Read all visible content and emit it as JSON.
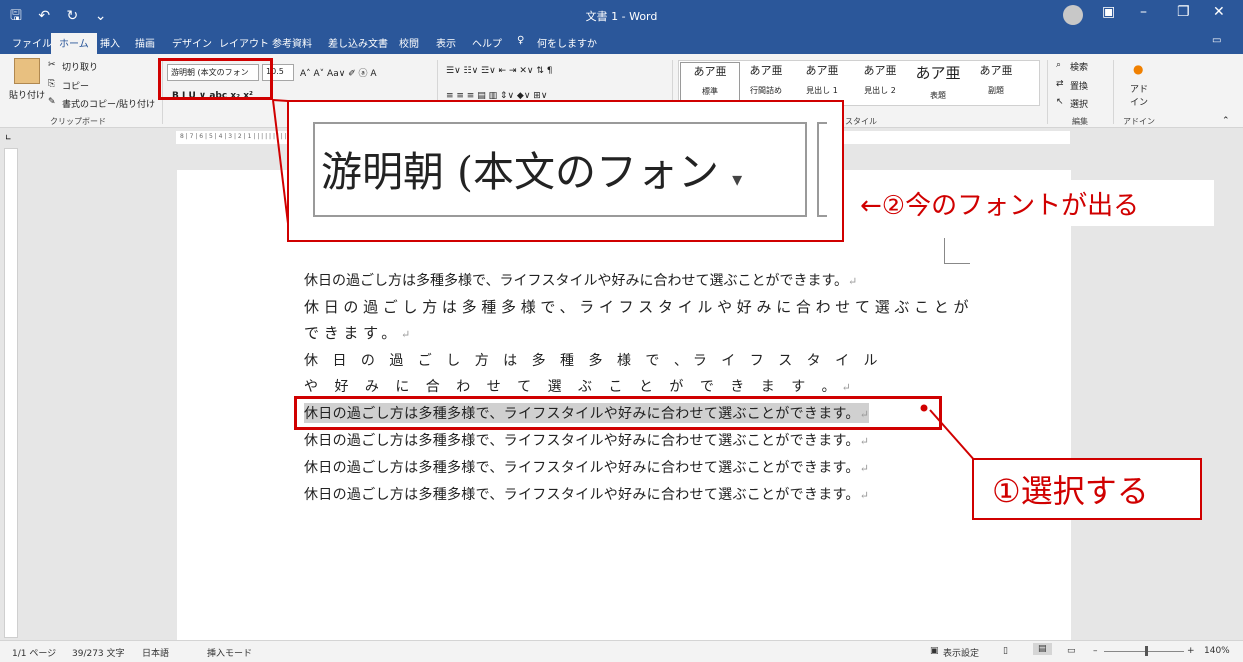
{
  "window": {
    "title": "文書 1  -  Word"
  },
  "tabs": [
    {
      "label": "ファイル",
      "active": false
    },
    {
      "label": "ホーム",
      "active": true
    },
    {
      "label": "挿入",
      "active": false
    },
    {
      "label": "描画",
      "active": false
    },
    {
      "label": "デザイン",
      "active": false
    },
    {
      "label": "レイアウト",
      "active": false
    },
    {
      "label": "参考資料",
      "active": false
    },
    {
      "label": "差し込み文書",
      "active": false
    },
    {
      "label": "校閲",
      "active": false
    },
    {
      "label": "表示",
      "active": false
    },
    {
      "label": "ヘルプ",
      "active": false
    }
  ],
  "tellme": "何をしますか",
  "clipboard": {
    "paste": "貼り付け",
    "cut": "切り取り",
    "copy": "コピー",
    "format_painter": "書式のコピー/貼り付け",
    "group": "クリップボード"
  },
  "font": {
    "name": "游明朝 (本文のフォン",
    "size": "10.5",
    "format_buttons": "B  I  U ∨  abc  x₂  x²"
  },
  "styles": {
    "items": [
      {
        "sample": "あア亜",
        "label": "標準"
      },
      {
        "sample": "あア亜",
        "label": "行間詰め"
      },
      {
        "sample": "あア亜",
        "label": "見出し 1"
      },
      {
        "sample": "あア亜",
        "label": "見出し 2"
      },
      {
        "sample": "あア亜",
        "label": "表題"
      },
      {
        "sample": "あア亜",
        "label": "副題"
      }
    ],
    "group": "スタイル"
  },
  "editing": {
    "find": "検索",
    "replace": "置換",
    "select": "選択",
    "group": "編集"
  },
  "addins": {
    "label": "アド\nイン",
    "group": "アドイン"
  },
  "ruler_text": "8 | 7 | 6 | 5 | 4 | 3 | 2 | 1 |      |      |      |      |      |      |      |      |      |      |      |      |      |      |      |      |      |      |      |      |      |      |      |      |      |      |      |      |      |      |      |      |      |      |      |      |      |      |      |      |      |      |      |      |      |      |      |      |      |      |      | 35 | 36 | 37 | 38 | 39 | 40 | 41 | 42 | 43 | 44 | 45 | 46 | 47 | 48 |",
  "document": {
    "lines": [
      "休日の過ごし方は多種多様で、ライフスタイルや好みに合わせて選ぶことができます。",
      "休日の過ごし方は多種多様で、ライフスタイルや好みに合わせて選ぶことが",
      "できます。",
      "休 日 の 過 ご し 方 は 多 種 多 様 で 、ラ イ フ ス タ イ ル",
      "や 好 み に 合 わ せ て 選 ぶ こ と が で き ま す 。",
      "休日の過ごし方は多種多様で、ライフスタイルや好みに合わせて選ぶことができます。",
      "休日の過ごし方は多種多様で、ライフスタイルや好みに合わせて選ぶことができます。",
      "休日の過ごし方は多種多様で、ライフスタイルや好みに合わせて選ぶことができます。",
      "休日の過ごし方は多種多様で、ライフスタイルや好みに合わせて選ぶことができます。"
    ],
    "paragraph_mark": "↵"
  },
  "zoom_panel": {
    "font_name": "游明朝 (本文のフォン"
  },
  "callouts": {
    "font_shown": "←②今のフォントが出る",
    "select": "①選択する"
  },
  "status": {
    "page": "1/1 ページ",
    "words": "39/273 文字",
    "language": "日本語",
    "mode": "挿入モード",
    "display_settings": "表示設定",
    "zoom": "140%"
  },
  "colors": {
    "accent": "#2b579a",
    "highlight": "#d00000",
    "selection": "#d0d0d0"
  }
}
